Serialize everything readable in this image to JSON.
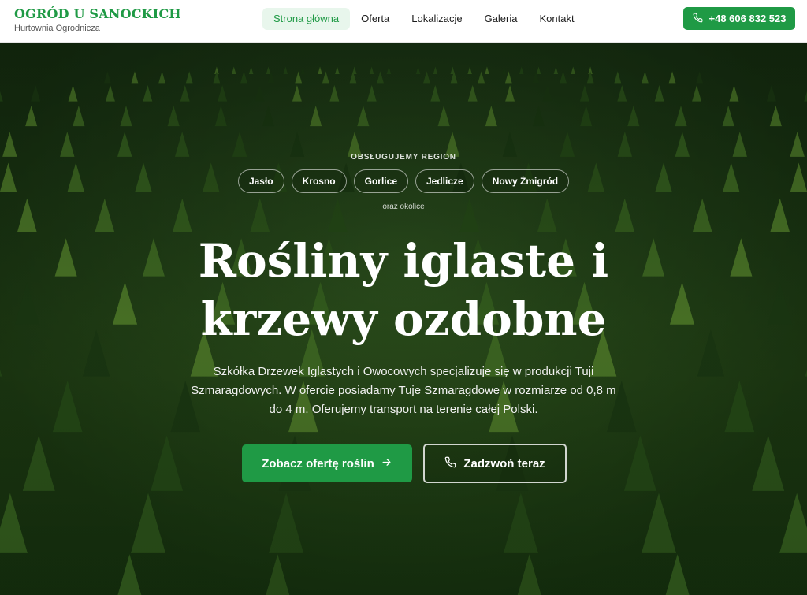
{
  "header": {
    "brand_title": "OGRÓD U SANOCKICH",
    "brand_subtitle": "Hurtownia Ogrodnicza",
    "nav": [
      {
        "label": "Strona główna",
        "active": true
      },
      {
        "label": "Oferta",
        "active": false
      },
      {
        "label": "Lokalizacje",
        "active": false
      },
      {
        "label": "Galeria",
        "active": false
      },
      {
        "label": "Kontakt",
        "active": false
      }
    ],
    "phone_label": "+48 606 832 523",
    "phone_icon": "phone-icon"
  },
  "hero": {
    "region_label": "OBSŁUGUJEMY REGION",
    "regions": [
      "Jasło",
      "Krosno",
      "Gorlice",
      "Jedlicze",
      "Nowy Żmigród"
    ],
    "surroundings": "oraz okolice",
    "title_line1": "Rośliny iglaste i",
    "title_line2": "krzewy ozdobne",
    "description": "Szkółka Drzewek Iglastych i Owocowych specjalizuje się w produkcji Tuji Szmaragdowych. W ofercie posiadamy Tuje Szmaragdowe w rozmiarze od 0,8 m do 4 m. Oferujemy transport na terenie całej Polski.",
    "cta_primary": "Zobacz ofertę roślin",
    "cta_primary_icon": "arrow-right-icon",
    "cta_secondary": "Zadzwoń teraz",
    "cta_secondary_icon": "phone-icon",
    "background_image": "rows of thuja trees"
  },
  "colors": {
    "brand_green": "#1f9a45",
    "nav_active_bg": "#e8f6ec"
  }
}
